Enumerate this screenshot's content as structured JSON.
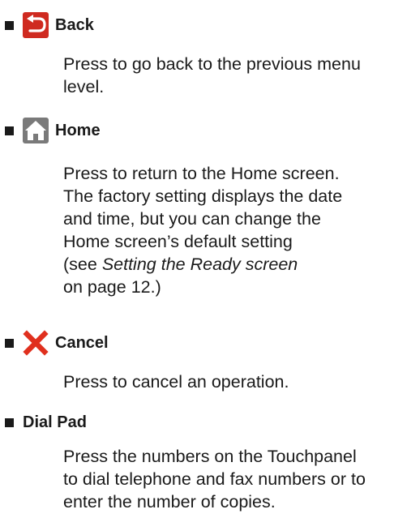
{
  "items": [
    {
      "icon": "back-arrow-icon",
      "title": "Back",
      "lines": [
        "Press to go back to the previous menu",
        "level."
      ]
    },
    {
      "icon": "home-icon",
      "title": "Home",
      "lines": [
        "Press to return to the Home screen.",
        "The factory setting displays the date",
        "and time, but you can change the",
        "Home screen’s default setting"
      ],
      "ref_prefix": "(see ",
      "ref_italic": "Setting the Ready screen",
      "ref_suffix": "on page 12.)"
    },
    {
      "icon": "cancel-x-icon",
      "title": "Cancel",
      "lines": [
        "Press to cancel an operation."
      ]
    },
    {
      "title": "Dial Pad",
      "lines": [
        "Press the numbers on the Touchpanel",
        "to dial telephone and fax numbers or to",
        "enter the number of copies."
      ]
    }
  ],
  "colors": {
    "text": "#1a1a1a",
    "icon_back_bg": "#cf2a20",
    "icon_home_bg": "#7a7a7a",
    "icon_cancel_x": "#e0301e"
  }
}
